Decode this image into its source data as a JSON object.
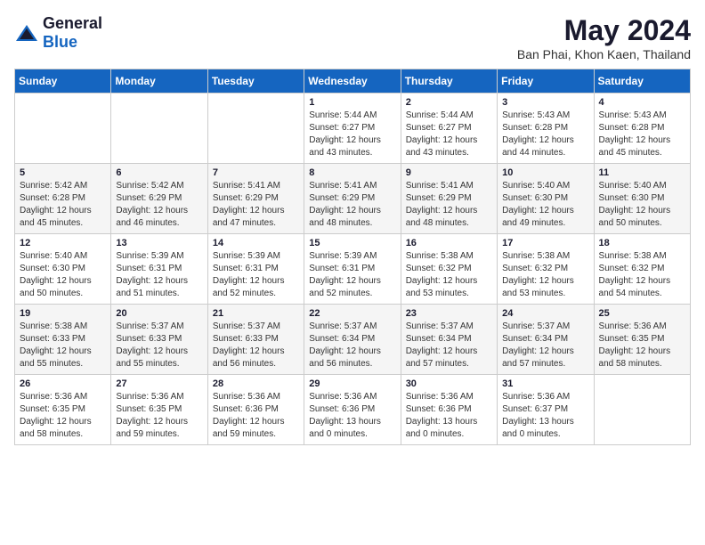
{
  "logo": {
    "general": "General",
    "blue": "Blue"
  },
  "title": "May 2024",
  "subtitle": "Ban Phai, Khon Kaen, Thailand",
  "days_of_week": [
    "Sunday",
    "Monday",
    "Tuesday",
    "Wednesday",
    "Thursday",
    "Friday",
    "Saturday"
  ],
  "weeks": [
    [
      {
        "day": "",
        "info": ""
      },
      {
        "day": "",
        "info": ""
      },
      {
        "day": "",
        "info": ""
      },
      {
        "day": "1",
        "info": "Sunrise: 5:44 AM\nSunset: 6:27 PM\nDaylight: 12 hours\nand 43 minutes."
      },
      {
        "day": "2",
        "info": "Sunrise: 5:44 AM\nSunset: 6:27 PM\nDaylight: 12 hours\nand 43 minutes."
      },
      {
        "day": "3",
        "info": "Sunrise: 5:43 AM\nSunset: 6:28 PM\nDaylight: 12 hours\nand 44 minutes."
      },
      {
        "day": "4",
        "info": "Sunrise: 5:43 AM\nSunset: 6:28 PM\nDaylight: 12 hours\nand 45 minutes."
      }
    ],
    [
      {
        "day": "5",
        "info": "Sunrise: 5:42 AM\nSunset: 6:28 PM\nDaylight: 12 hours\nand 45 minutes."
      },
      {
        "day": "6",
        "info": "Sunrise: 5:42 AM\nSunset: 6:29 PM\nDaylight: 12 hours\nand 46 minutes."
      },
      {
        "day": "7",
        "info": "Sunrise: 5:41 AM\nSunset: 6:29 PM\nDaylight: 12 hours\nand 47 minutes."
      },
      {
        "day": "8",
        "info": "Sunrise: 5:41 AM\nSunset: 6:29 PM\nDaylight: 12 hours\nand 48 minutes."
      },
      {
        "day": "9",
        "info": "Sunrise: 5:41 AM\nSunset: 6:29 PM\nDaylight: 12 hours\nand 48 minutes."
      },
      {
        "day": "10",
        "info": "Sunrise: 5:40 AM\nSunset: 6:30 PM\nDaylight: 12 hours\nand 49 minutes."
      },
      {
        "day": "11",
        "info": "Sunrise: 5:40 AM\nSunset: 6:30 PM\nDaylight: 12 hours\nand 50 minutes."
      }
    ],
    [
      {
        "day": "12",
        "info": "Sunrise: 5:40 AM\nSunset: 6:30 PM\nDaylight: 12 hours\nand 50 minutes."
      },
      {
        "day": "13",
        "info": "Sunrise: 5:39 AM\nSunset: 6:31 PM\nDaylight: 12 hours\nand 51 minutes."
      },
      {
        "day": "14",
        "info": "Sunrise: 5:39 AM\nSunset: 6:31 PM\nDaylight: 12 hours\nand 52 minutes."
      },
      {
        "day": "15",
        "info": "Sunrise: 5:39 AM\nSunset: 6:31 PM\nDaylight: 12 hours\nand 52 minutes."
      },
      {
        "day": "16",
        "info": "Sunrise: 5:38 AM\nSunset: 6:32 PM\nDaylight: 12 hours\nand 53 minutes."
      },
      {
        "day": "17",
        "info": "Sunrise: 5:38 AM\nSunset: 6:32 PM\nDaylight: 12 hours\nand 53 minutes."
      },
      {
        "day": "18",
        "info": "Sunrise: 5:38 AM\nSunset: 6:32 PM\nDaylight: 12 hours\nand 54 minutes."
      }
    ],
    [
      {
        "day": "19",
        "info": "Sunrise: 5:38 AM\nSunset: 6:33 PM\nDaylight: 12 hours\nand 55 minutes."
      },
      {
        "day": "20",
        "info": "Sunrise: 5:37 AM\nSunset: 6:33 PM\nDaylight: 12 hours\nand 55 minutes."
      },
      {
        "day": "21",
        "info": "Sunrise: 5:37 AM\nSunset: 6:33 PM\nDaylight: 12 hours\nand 56 minutes."
      },
      {
        "day": "22",
        "info": "Sunrise: 5:37 AM\nSunset: 6:34 PM\nDaylight: 12 hours\nand 56 minutes."
      },
      {
        "day": "23",
        "info": "Sunrise: 5:37 AM\nSunset: 6:34 PM\nDaylight: 12 hours\nand 57 minutes."
      },
      {
        "day": "24",
        "info": "Sunrise: 5:37 AM\nSunset: 6:34 PM\nDaylight: 12 hours\nand 57 minutes."
      },
      {
        "day": "25",
        "info": "Sunrise: 5:36 AM\nSunset: 6:35 PM\nDaylight: 12 hours\nand 58 minutes."
      }
    ],
    [
      {
        "day": "26",
        "info": "Sunrise: 5:36 AM\nSunset: 6:35 PM\nDaylight: 12 hours\nand 58 minutes."
      },
      {
        "day": "27",
        "info": "Sunrise: 5:36 AM\nSunset: 6:35 PM\nDaylight: 12 hours\nand 59 minutes."
      },
      {
        "day": "28",
        "info": "Sunrise: 5:36 AM\nSunset: 6:36 PM\nDaylight: 12 hours\nand 59 minutes."
      },
      {
        "day": "29",
        "info": "Sunrise: 5:36 AM\nSunset: 6:36 PM\nDaylight: 13 hours\nand 0 minutes."
      },
      {
        "day": "30",
        "info": "Sunrise: 5:36 AM\nSunset: 6:36 PM\nDaylight: 13 hours\nand 0 minutes."
      },
      {
        "day": "31",
        "info": "Sunrise: 5:36 AM\nSunset: 6:37 PM\nDaylight: 13 hours\nand 0 minutes."
      },
      {
        "day": "",
        "info": ""
      }
    ]
  ]
}
